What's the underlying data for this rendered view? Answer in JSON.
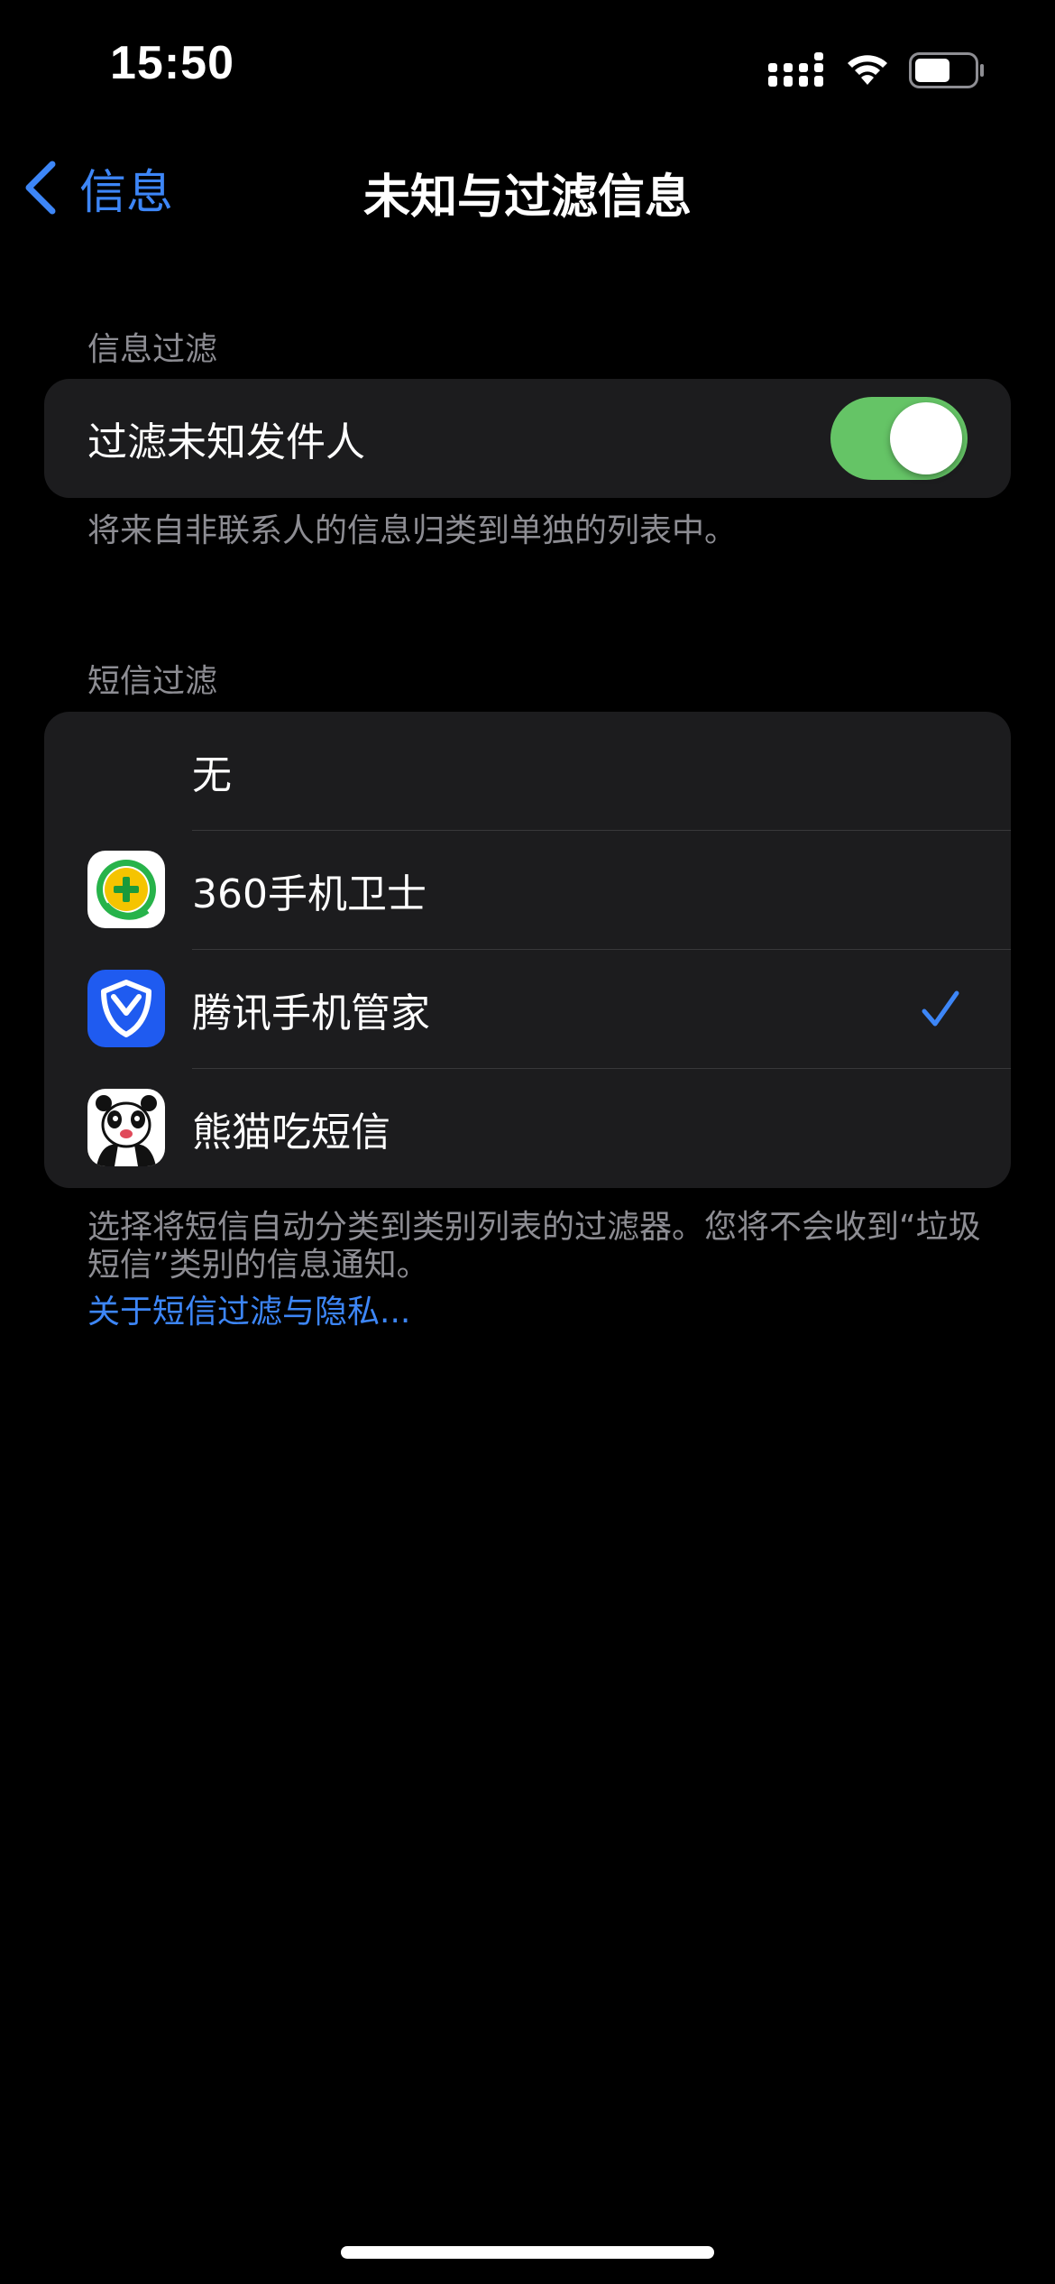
{
  "status_bar": {
    "time": "15:50",
    "icons": [
      "cellular-signal-icon",
      "wifi-icon",
      "battery-icon"
    ]
  },
  "nav": {
    "back_label": "信息",
    "title": "未知与过滤信息"
  },
  "section_filter": {
    "header": "信息过滤",
    "toggle_label": "过滤未知发件人",
    "toggle_on": true,
    "footer": "将来自非联系人的信息归类到单独的列表中。"
  },
  "section_sms": {
    "header": "短信过滤",
    "options": [
      {
        "label": "无",
        "icon": null,
        "selected": false
      },
      {
        "label": "360手机卫士",
        "icon": "360-security-app-icon",
        "selected": false
      },
      {
        "label": "腾讯手机管家",
        "icon": "tencent-manager-app-icon",
        "selected": true
      },
      {
        "label": "熊猫吃短信",
        "icon": "panda-sms-app-icon",
        "selected": false
      }
    ],
    "footer": "选择将短信自动分类到类别列表的过滤器。您将不会收到“垃圾短信”类别的信息通知。",
    "link": "关于短信过滤与隐私..."
  },
  "colors": {
    "accent": "#3d86f7",
    "toggle_on": "#65c466",
    "cell_background": "#1c1c1e",
    "secondary_text": "#8d8d93"
  }
}
